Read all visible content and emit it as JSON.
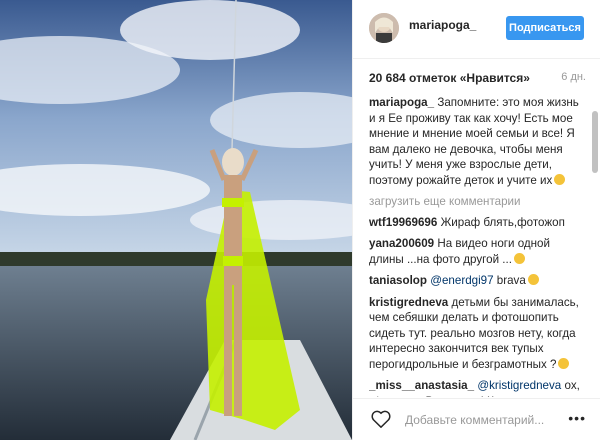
{
  "header": {
    "username": "mariapoga_",
    "follow_label": "Подписаться"
  },
  "likes": "20 684 отметок «Нравится»",
  "ago": "6 дн.",
  "caption": {
    "user": "mariapoga_",
    "text": "Запомните: это моя жизнь и я Ее проживу так как хочу! Есть мое мнение и мнение моей семьи и все! Я вам далеко не девочка, чтобы меня учить! У меня уже взрослые дети, поэтому рожайте деток и учите их"
  },
  "load_more": "загрузить еще комментарии",
  "comments": [
    {
      "user": "wtf19969696",
      "text": "Жираф блять,фотожоп"
    },
    {
      "user": "yana200609",
      "text": "На видео ноги одной длины ...на фото другой ..."
    },
    {
      "user": "taniasolop",
      "mention": "@enerdgi97",
      "text": "brava"
    },
    {
      "user": "kristigredneva",
      "text": "детьми бы занималась, чем себяшки делать и фотошопить сидеть тут. реально мозгов нету, когда интересно закончится век тупых перогидрольные и безграмотных ?"
    },
    {
      "user": "_miss__anastasia_",
      "mention": "@kristigredneva",
      "text": "ох, е*ать, все Вы знаете! Кому и чем"
    }
  ],
  "footer": {
    "placeholder": "Добавьте комментарий...",
    "more_label": "•••",
    "heart_icon": "heart-outline-icon"
  },
  "colors": {
    "accent": "#3897f0",
    "swimsuit": "#c4f000"
  }
}
